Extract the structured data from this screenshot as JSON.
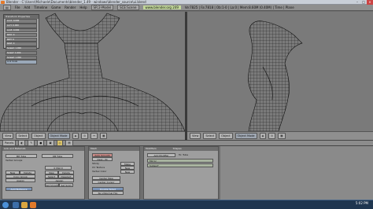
{
  "window": {
    "title": "Blender - C:\\Users\\Michaele\\Documents\\blender_1.49 - windows\\blender_source\\ui.blend"
  },
  "menubar": {
    "items": [
      "File",
      "Add",
      "Timeline",
      "Game",
      "Render",
      "Help"
    ],
    "screen": "SR:2-Model",
    "scene": "SCE:Scene",
    "url": "www.blender.org 249",
    "stats": "Ve:7825 | Fa:7818 | Ob:1-0 | La:0 | Mem:8.60M (0.40M) | Time | Plane"
  },
  "transform_panel": {
    "title": "Transform Properties",
    "rows": [
      "LocX: 0.000",
      "LocY: 0.000",
      "LocZ: 0.000",
      "RotX: 0",
      "RotY: 0",
      "RotZ: 0",
      "ScaleX: 1.000",
      "ScaleY: 1.000",
      "ScaleZ: 1.000"
    ],
    "link_label": "Link Scale"
  },
  "viewport_header": {
    "view": "View",
    "select": "Select",
    "object": "Object",
    "mode": "Object Mode"
  },
  "buttons_header": {
    "panels": "Panels"
  },
  "link_materials": {
    "title": "Link and Materials",
    "mesh_name": "ME:Tube",
    "object_name": "OB:Tube",
    "vertex_groups": "Vertex Groups",
    "material_slot": "0 Mat 0",
    "new": "New",
    "delete": "Delete",
    "copy_group": "Copy Group",
    "assign": "Assign",
    "select": "Select",
    "deselect": "Deselect",
    "autotexspace": "AutoTexSpace",
    "set_smooth": "Set Smooth",
    "set_solid": "Set Solid"
  },
  "mesh_panel": {
    "title": "Mesh",
    "auto_smooth": "Auto Smooth",
    "degr": "Degr: 30",
    "sticky": "Sticky",
    "uv_texture": "UV Texture",
    "vertex_color": "Vertex Color",
    "make": "Make",
    "new": "New",
    "center": "Center",
    "center_new": "Center New",
    "center_cursor": "Center Cursor",
    "double_sided": "Double Sided",
    "no_vnormal_flip": "No V.Normal Flip"
  },
  "modifiers_panel": {
    "tabs": [
      "Modifiers",
      "Shapes"
    ],
    "add_modifier": "Add Modifier",
    "to": "To: Tube",
    "modifiers": [
      "Mirror",
      "Subsurf"
    ]
  },
  "taskbar": {
    "time": "5:02 PM",
    "date": "7/14/2011"
  },
  "colors": {
    "viewport": "#7a7a7a",
    "panel": "#9e9e9e",
    "taskbar": "#1f3650",
    "mesh_wire": "#111111"
  }
}
